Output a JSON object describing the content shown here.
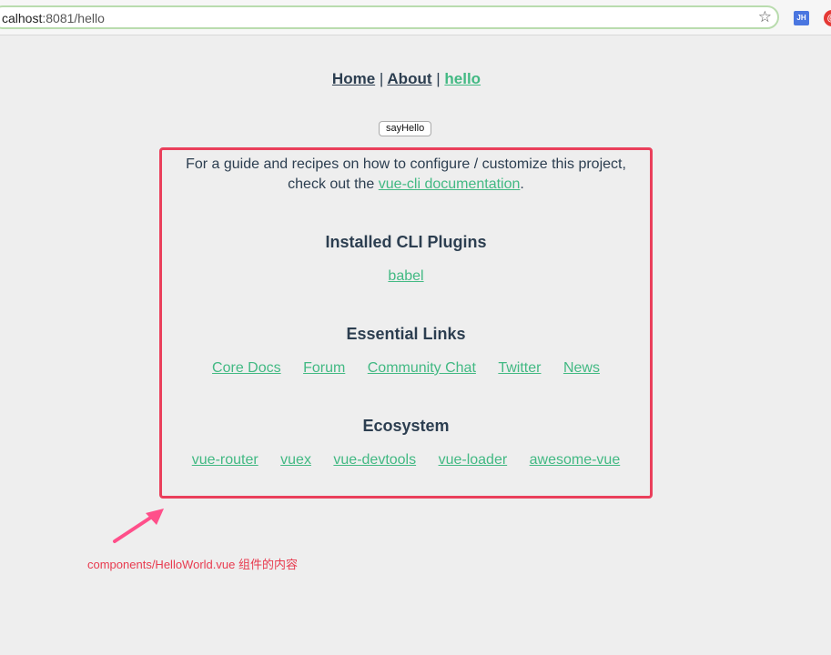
{
  "browser": {
    "url_host": "calhost",
    "url_rest": ":8081/hello",
    "extensions": [
      "JH",
      "@"
    ]
  },
  "nav": {
    "home": "Home",
    "about": "About",
    "hello": "hello",
    "separator": "|"
  },
  "say_hello_button": "sayHello",
  "hello_world": {
    "intro_prefix": "For a guide and recipes on how to configure / customize this project,",
    "intro_line2_prefix": "check out the",
    "intro_link": "vue-cli documentation",
    "intro_suffix": ".",
    "sections": [
      {
        "title": "Installed CLI Plugins",
        "links": [
          "babel"
        ]
      },
      {
        "title": "Essential Links",
        "links": [
          "Core Docs",
          "Forum",
          "Community Chat",
          "Twitter",
          "News"
        ]
      },
      {
        "title": "Ecosystem",
        "links": [
          "vue-router",
          "vuex",
          "vue-devtools",
          "vue-loader",
          "awesome-vue"
        ]
      }
    ]
  },
  "annotation": "components/HelloWorld.vue 组件的内容",
  "colors": {
    "accent": "#42b983",
    "text": "#2c3e50",
    "highlight": "#ea3f5b",
    "annotation": "#e83b4f"
  }
}
